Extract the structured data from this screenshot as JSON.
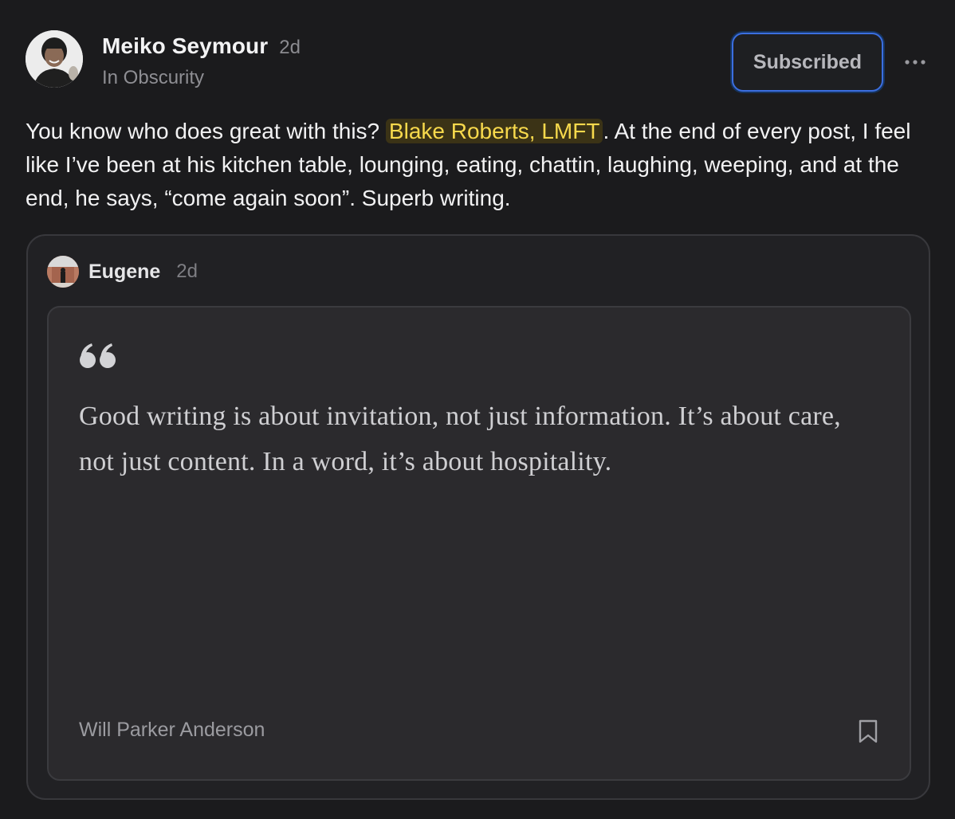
{
  "post": {
    "author_name": "Meiko Seymour",
    "time_ago": "2d",
    "publication": "In Obscurity",
    "subscribe_label": "Subscribed",
    "more_icon": "more-horizontal-icon",
    "body_before": "You know who does great with this? ",
    "mention": "Blake Roberts, LMFT",
    "body_after": ". At the end of every post, I feel like I’ve been at his kitchen table, lounging, eating, chattin, laughing, weeping, and at the end, he says, “come again soon”. Superb writing."
  },
  "quoted_note": {
    "author_name": "Eugene",
    "time_ago": "2d",
    "quote_icon": "quote-mark-icon",
    "quote_text": "Good writing is about invitation, not just information. It’s about care, not just content. In a word, it’s about hospitality.",
    "attribution": "Will Parker Anderson",
    "bookmark_icon": "bookmark-icon"
  },
  "colors": {
    "background": "#1b1b1d",
    "mention_text": "#f7d94c",
    "mention_bg": "#3b3316",
    "button_focus_ring": "#3b6ee0"
  }
}
